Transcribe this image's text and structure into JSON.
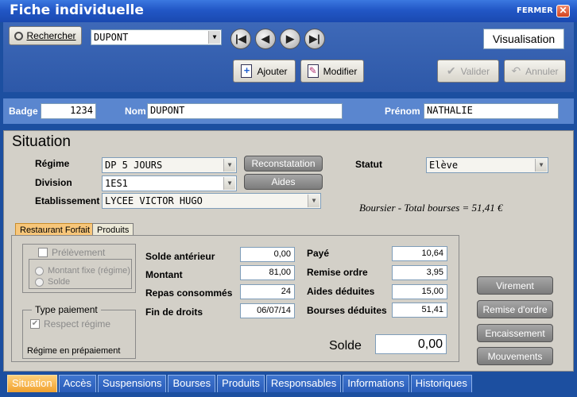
{
  "window": {
    "title": "Fiche individuelle",
    "close_label": "FERMER",
    "close_glyph": "✕"
  },
  "toolbar": {
    "search_label": "Rechercher",
    "name_combo_value": "DUPONT",
    "mode_label": "Visualisation",
    "ajouter_label": "Ajouter",
    "modifier_label": "Modifier",
    "valider_label": "Valider",
    "annuler_label": "Annuler",
    "nav": {
      "first": "|◀",
      "prev": "◀",
      "next": "▶",
      "last": "▶|"
    }
  },
  "identity": {
    "badge_label": "Badge",
    "badge_value": "1234",
    "nom_label": "Nom",
    "nom_value": "DUPONT",
    "prenom_label": "Prénom",
    "prenom_value": "NATHALIE"
  },
  "situation": {
    "heading": "Situation",
    "regime_label": "Régime",
    "regime_value": "DP 5 JOURS",
    "division_label": "Division",
    "division_value": "1ES1",
    "etablissement_label": "Etablissement",
    "etablissement_value": "LYCEE VICTOR HUGO",
    "reconstatation_label": "Reconstatation",
    "aides_label": "Aides",
    "statut_label": "Statut",
    "statut_value": "Elève",
    "boursier_text": "Boursier - Total bourses = 51,41 €"
  },
  "inner_tabs": [
    {
      "label": "Restaurant Forfait",
      "active": true
    },
    {
      "label": "Produits",
      "active": false
    }
  ],
  "forfait": {
    "prelevement_label": "Prélèvement",
    "montant_fixe_label": "Montant fixe (régime)",
    "solde_radio_label": "Solde",
    "type_paiement_label": "Type paiement",
    "respect_regime_label": "Respect régime",
    "regime_prepaiement_label": "Régime en prépaiement"
  },
  "amounts": {
    "solde_anterieur_label": "Solde antérieur",
    "solde_anterieur_value": "0,00",
    "montant_label": "Montant",
    "montant_value": "81,00",
    "repas_label": "Repas consommés",
    "repas_value": "24",
    "fin_droits_label": "Fin de droits",
    "fin_droits_value": "06/07/14",
    "paye_label": "Payé",
    "paye_value": "10,64",
    "remise_label": "Remise ordre",
    "remise_value": "3,95",
    "aides_deduites_label": "Aides déduites",
    "aides_deduites_value": "15,00",
    "bourses_deduites_label": "Bourses déduites",
    "bourses_deduites_value": "51,41",
    "solde_label": "Solde",
    "solde_value": "0,00"
  },
  "side_buttons": {
    "virement": "Virement",
    "remise_ordre": "Remise d'ordre",
    "encaissement": "Encaissement",
    "mouvements": "Mouvements"
  },
  "bottom_tabs": [
    {
      "label": "Situation",
      "active": true
    },
    {
      "label": "Accès",
      "active": false
    },
    {
      "label": "Suspensions",
      "active": false
    },
    {
      "label": "Bourses",
      "active": false
    },
    {
      "label": "Produits",
      "active": false
    },
    {
      "label": "Responsables",
      "active": false
    },
    {
      "label": "Informations",
      "active": false
    },
    {
      "label": "Historiques",
      "active": false
    }
  ],
  "colors": {
    "frame": "#1c4fa0",
    "band": "#5a86cf",
    "active_tab": "#f0a12e"
  }
}
